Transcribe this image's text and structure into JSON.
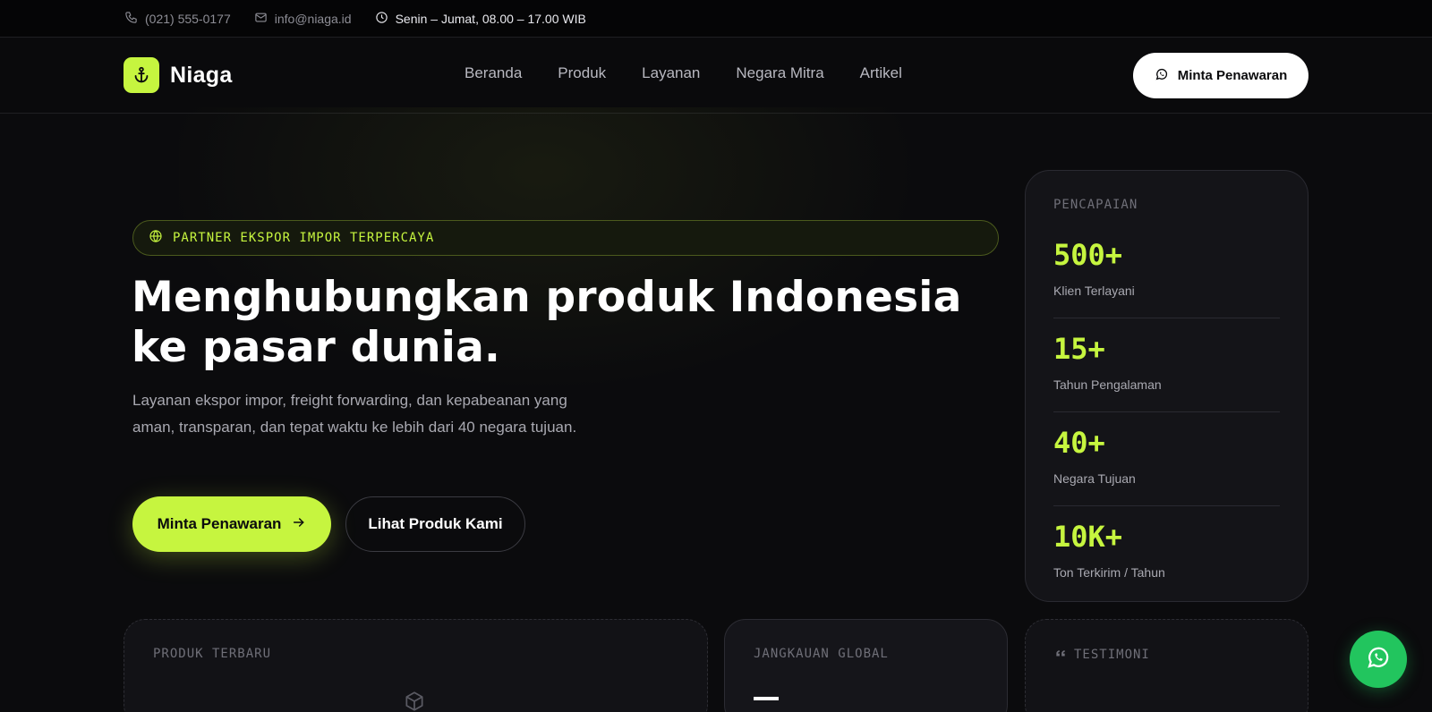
{
  "topbar": {
    "phone": "(021) 555-0177",
    "email": "info@niaga.id",
    "hours": "Senin – Jumat, 08.00 – 17.00 WIB"
  },
  "nav": {
    "brand": "Niaga",
    "links": [
      "Beranda",
      "Produk",
      "Layanan",
      "Negara Mitra",
      "Artikel"
    ],
    "cta_label": "Minta Penawaran"
  },
  "hero": {
    "badge": "PARTNER EKSPOR IMPOR TERPERCAYA",
    "title": "Menghubungkan produk Indonesia ke pasar dunia.",
    "description": "Layanan ekspor impor, freight forwarding, dan kepabeanan yang aman, transparan, dan tepat waktu ke lebih dari 40 negara tujuan.",
    "primary_label": "Minta Penawaran",
    "secondary_label": "Lihat Produk Kami"
  },
  "stats": {
    "label": "PENCAPAIAN",
    "items": [
      {
        "value": "500+",
        "label": "Klien Terlayani"
      },
      {
        "value": "15+",
        "label": "Tahun Pengalaman"
      },
      {
        "value": "40+",
        "label": "Negara Tujuan"
      },
      {
        "value": "10K+",
        "label": "Ton Terkirim / Tahun"
      }
    ]
  },
  "cards": {
    "products": "PRODUK TERBARU",
    "reach": "JANGKAUAN GLOBAL",
    "testimonials": "TESTIMONI"
  },
  "colors": {
    "accent": "#c6f53f",
    "background": "#0b0b0d",
    "whatsapp": "#22c55e"
  },
  "icons": [
    "phone-icon",
    "mail-icon",
    "clock-icon",
    "anchor-icon",
    "globe-icon",
    "arrow-right-icon",
    "whatsapp-icon",
    "cube-icon",
    "quote-icon"
  ]
}
